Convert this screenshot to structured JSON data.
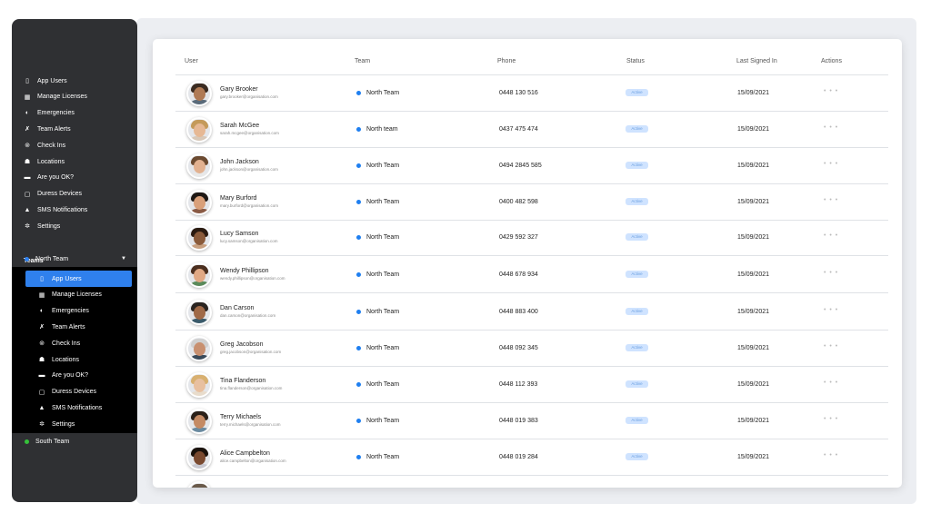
{
  "sidebar": {
    "top_items": [
      {
        "label": "App Users",
        "icon": "phone-icon",
        "glyph": "▯"
      },
      {
        "label": "Manage Licenses",
        "icon": "qr-icon",
        "glyph": "▦"
      },
      {
        "label": "Emergencies",
        "icon": "emergency-icon",
        "glyph": "◐"
      },
      {
        "label": "Team Alerts",
        "icon": "runner-icon",
        "glyph": "✗"
      },
      {
        "label": "Check Ins",
        "icon": "location-pin-icon",
        "glyph": "⊚"
      },
      {
        "label": "Locations",
        "icon": "home-icon",
        "glyph": "☗"
      },
      {
        "label": "Are you OK?",
        "icon": "chat-icon",
        "glyph": "▬"
      },
      {
        "label": "Duress Devices",
        "icon": "device-icon",
        "glyph": "▢"
      },
      {
        "label": "SMS Notifications",
        "icon": "bell-icon",
        "glyph": "▲"
      },
      {
        "label": "Settings",
        "icon": "gear-icon",
        "glyph": "✲"
      }
    ],
    "teams_label": "Teams",
    "teams": [
      {
        "label": "North Team",
        "color": "#2f80ed",
        "expanded": true
      },
      {
        "label": "South Team",
        "color": "#35c13a",
        "expanded": false
      }
    ],
    "sub_items": [
      {
        "label": "App Users",
        "icon": "phone-icon",
        "glyph": "▯",
        "active": true
      },
      {
        "label": "Manage Licenses",
        "icon": "qr-icon",
        "glyph": "▦"
      },
      {
        "label": "Emergencies",
        "icon": "emergency-icon",
        "glyph": "◐"
      },
      {
        "label": "Team Alerts",
        "icon": "runner-icon",
        "glyph": "✗"
      },
      {
        "label": "Check Ins",
        "icon": "location-pin-icon",
        "glyph": "⊚"
      },
      {
        "label": "Locations",
        "icon": "home-icon",
        "glyph": "☗"
      },
      {
        "label": "Are you OK?",
        "icon": "chat-icon",
        "glyph": "▬"
      },
      {
        "label": "Duress Devices",
        "icon": "device-icon",
        "glyph": "▢"
      },
      {
        "label": "SMS Notifications",
        "icon": "bell-icon",
        "glyph": "▲"
      },
      {
        "label": "Settings",
        "icon": "gear-icon",
        "glyph": "✲"
      }
    ]
  },
  "table": {
    "headers": {
      "user": "User",
      "team": "Team",
      "phone": "Phone",
      "status": "Status",
      "last": "Last Signed In",
      "actions": "Actions"
    },
    "rows": [
      {
        "name": "Gary Brooker",
        "email": "gary.brooker@organisation.com",
        "team": "North Team",
        "phone": "0448 130 516",
        "status": "Active",
        "date": "15/09/2021",
        "actions": "• • •",
        "skin": "#b07a55",
        "hair": "#3a2a20",
        "shirt": "#5a6b7a"
      },
      {
        "name": "Sarah McGee",
        "email": "sarah.mcgee@organisation.com",
        "team": "North team",
        "phone": "0437 475 474",
        "status": "Active",
        "date": "15/09/2021",
        "actions": "• • •",
        "skin": "#e6b894",
        "hair": "#c49a5a",
        "shirt": "#d8c8b8"
      },
      {
        "name": "John Jackson",
        "email": "john.jackson@organisation.com",
        "team": "North Team",
        "phone": "0494 2845 585",
        "status": "Active",
        "date": "15/09/2021",
        "actions": "• • •",
        "skin": "#e2b190",
        "hair": "#6b4a30",
        "shirt": "#e8e8e8"
      },
      {
        "name": "Mary Burford",
        "email": "mary.burford@organisation.com",
        "team": "North Team",
        "phone": "0400 482 598",
        "status": "Active",
        "date": "15/09/2021",
        "actions": "• • •",
        "skin": "#d9a07a",
        "hair": "#1e1814",
        "shirt": "#8a5a44"
      },
      {
        "name": "Lucy Samson",
        "email": "lucy.samson@organisation.com",
        "team": "North Team",
        "phone": "0429 592 327",
        "status": "Active",
        "date": "15/09/2021",
        "actions": "• • •",
        "skin": "#8a5a3a",
        "hair": "#2a1a10",
        "shirt": "#c8a080"
      },
      {
        "name": "Wendy Phillipson",
        "email": "wendy.phillipson@organisation.com",
        "team": "North Team",
        "phone": "0448 678 934",
        "status": "Active",
        "date": "15/09/2021",
        "actions": "• • •",
        "skin": "#e0a884",
        "hair": "#4a2e1e",
        "shirt": "#5a8a5a"
      },
      {
        "name": "Dan Carson",
        "email": "dan.carson@organisation.com",
        "team": "North Team",
        "phone": "0448 883 400",
        "status": "Active",
        "date": "15/09/2021",
        "actions": "• • •",
        "skin": "#a06a48",
        "hair": "#2a2420",
        "shirt": "#3a5a6a"
      },
      {
        "name": "Greg Jacobson",
        "email": "greg.jacobson@organisation.com",
        "team": "North Team",
        "phone": "0448 092 345",
        "status": "Active",
        "date": "15/09/2021",
        "actions": "• • •",
        "skin": "#c89070",
        "hair": "#d0d0d0",
        "shirt": "#3a4a5a"
      },
      {
        "name": "Tina Flanderson",
        "email": "tina.flanderson@organisation.com",
        "team": "North Team",
        "phone": "0448 112 393",
        "status": "Active",
        "date": "15/09/2021",
        "actions": "• • •",
        "skin": "#e8c0a0",
        "hair": "#d8b070",
        "shirt": "#e8dccc"
      },
      {
        "name": "Terry Michaels",
        "email": "terry.michaels@organisation.com",
        "team": "North Team",
        "phone": "0448 019 383",
        "status": "Active",
        "date": "15/09/2021",
        "actions": "• • •",
        "skin": "#c48a64",
        "hair": "#2a2018",
        "shirt": "#6a8aa0"
      },
      {
        "name": "Alice Campbelton",
        "email": "alice.campbelton@organisation.com",
        "team": "North Team",
        "phone": "0448 019 284",
        "status": "Active",
        "date": "15/09/2021",
        "actions": "• • •",
        "skin": "#7a4a30",
        "hair": "#1a120c",
        "shirt": "#c8c8d0"
      }
    ]
  }
}
